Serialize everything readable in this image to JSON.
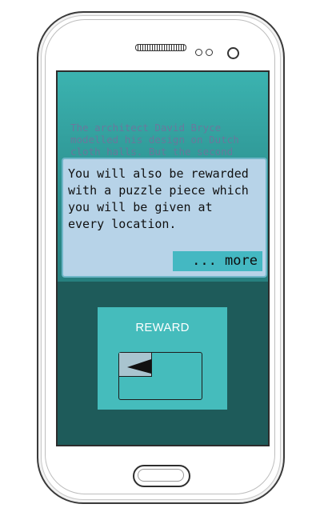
{
  "background_text": "The architect David Bryce modelled his design on Dutch cloth halls. But the second",
  "dialog": {
    "message": "You will also be rewarded\nwith a puzzle piece which\nyou will be given at\nevery location.",
    "more_label": "... more"
  },
  "reward": {
    "title": "REWARD"
  },
  "colors": {
    "screen_accent": "#3bb3b0",
    "screen_dark": "#1e5b5a",
    "dialog_bg": "#b7d3e8",
    "more_button": "#44b8c2",
    "reward_panel": "#45bcbc"
  },
  "icons": {
    "puzzle": "puzzle-piece-icon"
  }
}
